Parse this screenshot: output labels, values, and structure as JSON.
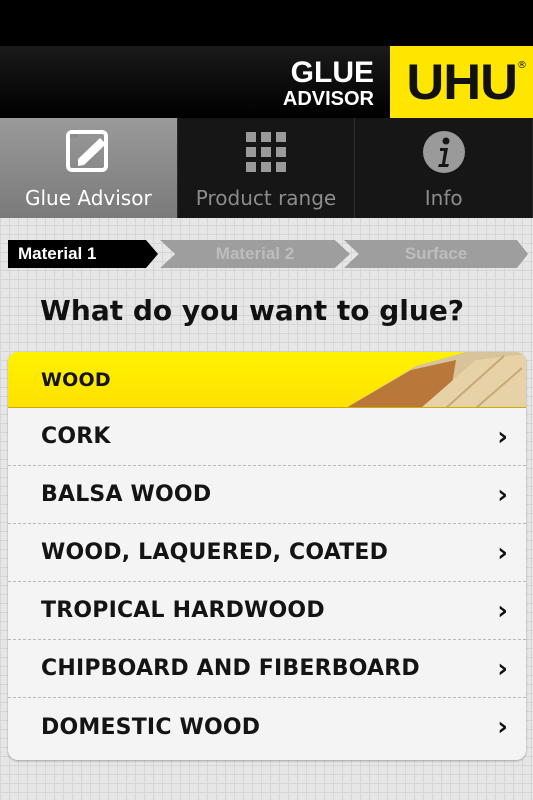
{
  "app": {
    "logo_line1": "GLUE",
    "logo_line2": "ADVISOR",
    "brand": "UHU",
    "brand_mark": "®",
    "accent_color": "#ffe600"
  },
  "tabs": [
    {
      "label": "Glue Advisor",
      "icon": "pencil-note-icon",
      "active": true
    },
    {
      "label": "Product range",
      "icon": "grid-icon",
      "active": false
    },
    {
      "label": "Info",
      "icon": "info-icon",
      "active": false
    }
  ],
  "steps": [
    {
      "label": "Material 1",
      "active": true
    },
    {
      "label": "Material 2",
      "active": false
    },
    {
      "label": "Surface",
      "active": false
    }
  ],
  "question": "What do you want to glue?",
  "category": "WOOD",
  "materials": [
    "CORK",
    "BALSA WOOD",
    "WOOD, LAQUERED, COATED",
    "TROPICAL HARDWOOD",
    "CHIPBOARD AND FIBERBOARD",
    "DOMESTIC WOOD"
  ],
  "chevron": "›"
}
